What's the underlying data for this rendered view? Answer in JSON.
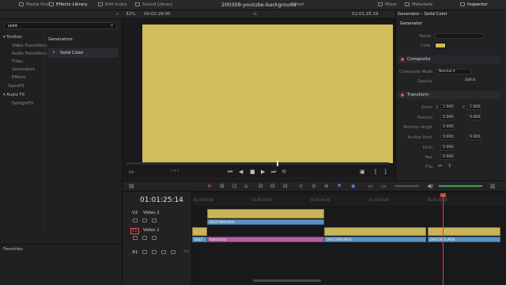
{
  "topbar": {
    "media_pool": "Media Pool",
    "effects_library": "Effects Library",
    "edit_index": "Edit Index",
    "sound_library": "Sound Library",
    "project_title": "200309-youtube-background",
    "edited": "Edited",
    "mixer": "Mixer",
    "metadata": "Metadata",
    "inspector": "Inspector"
  },
  "viewer": {
    "zoom": "32%",
    "source_timecode": "00:02:28:00",
    "record_timecode": "01:01:25:19",
    "timeline_timecode": "01:01:25:14"
  },
  "effects": {
    "search_value": "solid",
    "tree": [
      {
        "label": "Toolbox",
        "header": true
      },
      {
        "label": "Video Transitions"
      },
      {
        "label": "Audio Transitions"
      },
      {
        "label": "Titles"
      },
      {
        "label": "Generators"
      },
      {
        "label": "Effects"
      },
      {
        "label": "OpenFX",
        "header": false
      },
      {
        "label": "Audio FX",
        "header": true
      },
      {
        "label": "FairlightFX"
      }
    ],
    "generators_header": "Generators",
    "generator_item": "Solid Color",
    "favorites": "Favorites"
  },
  "inspector": {
    "title": "Generator - Solid Color",
    "generator_section": "Generator",
    "name_label": "Name",
    "color_label": "Color",
    "swatch_color": "#d3bc5a",
    "composite_section": "Composite",
    "composite_mode_label": "Composite Mode",
    "composite_mode_value": "Normal",
    "opacity_label": "Opacity",
    "opacity_value": "100.0",
    "transform_section": "Transform",
    "zoom_label": "Zoom",
    "zoom_x": "1.000",
    "zoom_y": "1.000",
    "position_label": "Position",
    "position_x": "0.000",
    "position_y": "0.000",
    "rotation_label": "Rotation Angle",
    "rotation_value": "0.000",
    "anchor_label": "Anchor Point",
    "anchor_x": "0.000",
    "anchor_y": "0.000",
    "pitch_label": "Pitch",
    "pitch_value": "0.000",
    "yaw_label": "Yaw",
    "yaw_value": "0.000",
    "flip_label": "Flip",
    "x_label": "X",
    "y_label": "Y"
  },
  "timeline": {
    "ruler": [
      "01:00:00:00",
      "01:00:20:00",
      "01:00:40:00",
      "01:01:00:00",
      "01:01:20:00"
    ],
    "tracks": [
      {
        "id": "V2",
        "name": "Video 2"
      },
      {
        "id": "V1",
        "name": "Video 1"
      },
      {
        "id": "A1",
        "name": "",
        "level": "2.0"
      }
    ],
    "clips": {
      "v2_audio": "DSCF7868.MOV",
      "v1_first": "DSCF",
      "v1_solid": "Solid Color",
      "v1_b": "DSCF7869.MOV",
      "v1_c": "DSCF7801.MOV"
    }
  }
}
